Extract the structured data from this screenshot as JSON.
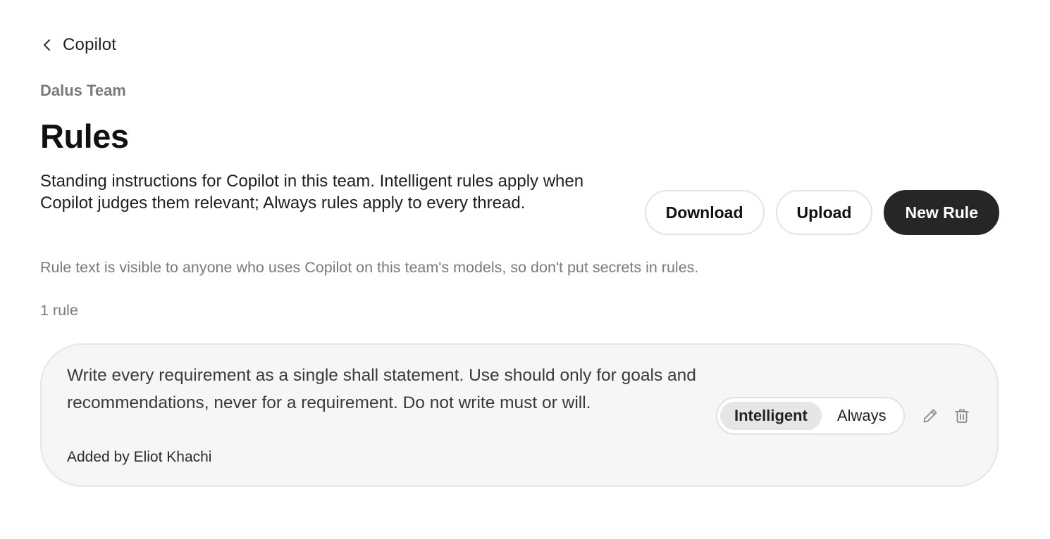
{
  "nav": {
    "back_label": "Copilot",
    "back_icon": "chevron-left-icon"
  },
  "header": {
    "team_name": "Dalus Team",
    "title": "Rules",
    "description": "Standing instructions for Copilot in this team. Intelligent rules apply when Copilot judges them relevant; Always rules apply to every thread."
  },
  "actions": {
    "download_label": "Download",
    "upload_label": "Upload",
    "new_rule_label": "New Rule"
  },
  "notice": "Rule text is visible to anyone who uses Copilot on this team's models, so don't put secrets in rules.",
  "rule_count": "1 rule",
  "rules": [
    {
      "text": "Write every requirement as a single shall statement. Use should only for goals and recommendations, never for a requirement. Do not write must or will.",
      "author": "Added by Eliot Khachi",
      "modes": [
        "Intelligent",
        "Always"
      ],
      "selected_mode": "Intelligent",
      "edit_icon": "pencil-icon",
      "delete_icon": "trash-icon"
    }
  ],
  "colors": {
    "primary_button": "#262626",
    "muted_text": "#7a7a7a",
    "card_background": "#f6f6f6",
    "toggle_active": "#e6e6e6"
  }
}
